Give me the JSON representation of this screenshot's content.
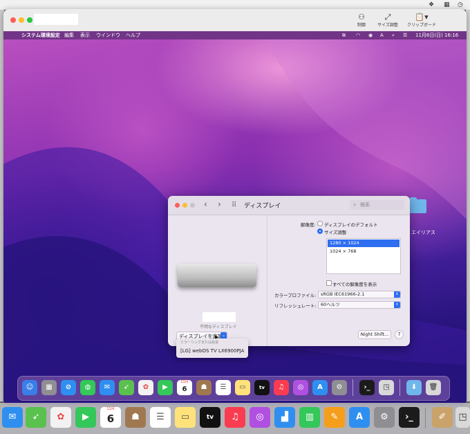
{
  "host": {
    "right_icons": [
      "dropbox-icon",
      "grid-icon",
      "clock-icon"
    ]
  },
  "window": {
    "toolbar": {
      "control_label": "制御",
      "resize_label": "サイズ調整",
      "clipboard_label": "クリップボード"
    }
  },
  "remote_menubar": {
    "apple": "",
    "items": [
      "システム環境設定",
      "編集",
      "表示",
      "ウインドウ",
      "ヘルプ"
    ],
    "date_time": "11月6日(日)  16:16"
  },
  "desktop": {
    "folder_label": "エイリアス"
  },
  "prefs": {
    "title": "ディスプレイ",
    "search_placeholder": "検索",
    "unknown_display": "不明なディスプレイ",
    "add_display_button": "ディスプレイを追加",
    "dropdown": {
      "header": "ミラーリングまたは拡張",
      "item": "[LG] webOS TV LX6900PJA"
    },
    "resolution_label": "解像度:",
    "radio_default": "ディスプレイのデフォルト",
    "radio_scaled": "サイズ調整",
    "resolutions": [
      "1280 × 1024",
      "1024 × 768"
    ],
    "show_all_label": "すべての解像度を表示",
    "color_profile_label": "カラープロファイル:",
    "color_profile_value": "sRGB IEC61966-2.1",
    "refresh_label": "リフレッシュレート:",
    "refresh_value": "60ヘルツ",
    "night_shift_button": "Night Shift...",
    "help_button": "?"
  },
  "dock_remote": {
    "calendar_month": "11月",
    "calendar_day": "6",
    "tv_label": "tv"
  },
  "dock_host": {
    "calendar_month": "11月",
    "calendar_day": "6",
    "tv_label": "tv"
  },
  "colors": {
    "accent": "#2e6ef0",
    "menubar": "#7a378c"
  }
}
